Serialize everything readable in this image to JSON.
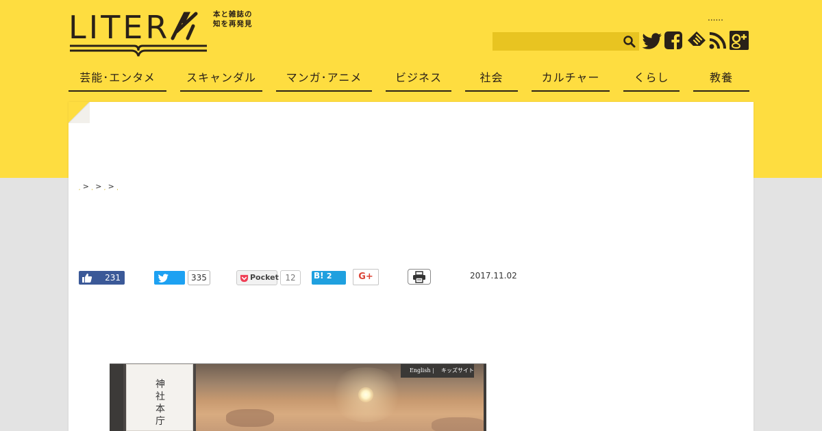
{
  "brand": {
    "logo_word": "LITER",
    "tagline": "本と雑誌の知を再発見",
    "colors": {
      "background_yellow": "#fedd40",
      "ink": "#2a2118",
      "search_field": "#e8c421",
      "page_gray": "#e3e3e3"
    }
  },
  "header": {
    "dots": "......",
    "search": {
      "value": "",
      "icon": "search-icon"
    },
    "social": [
      {
        "name": "twitter",
        "icon": "twitter-icon"
      },
      {
        "name": "facebook",
        "icon": "facebook-icon"
      },
      {
        "name": "feedly",
        "icon": "feedly-icon"
      },
      {
        "name": "rss",
        "icon": "rss-icon"
      },
      {
        "name": "google-plus",
        "icon": "google-plus-icon"
      }
    ]
  },
  "nav": [
    {
      "label": "芸能･エンタメ"
    },
    {
      "label": "スキャンダル"
    },
    {
      "label": "マンガ･アニメ"
    },
    {
      "label": "ビジネス"
    },
    {
      "label": "社会"
    },
    {
      "label": "カルチャー"
    },
    {
      "label": "くらし"
    },
    {
      "label": "教養"
    }
  ],
  "breadcrumb": {
    "separators": [
      ">",
      ">",
      ">"
    ]
  },
  "share": {
    "facebook_count": "231",
    "twitter_count": "335",
    "pocket_label": "Pocket",
    "pocket_count": "12",
    "hatena_label": "B!",
    "hatena_count": "2",
    "gplus_label": "G+",
    "print_icon": "print-icon",
    "colors": {
      "facebook": "#3b5998",
      "twitter": "#1da1f2",
      "hatena": "#1fa0df",
      "gplus": "#db4437"
    }
  },
  "article": {
    "date": "2017.11.02",
    "image": {
      "shrine_title": "神社本庁",
      "link_english": "English",
      "link_kids": "キッズサイト"
    }
  }
}
